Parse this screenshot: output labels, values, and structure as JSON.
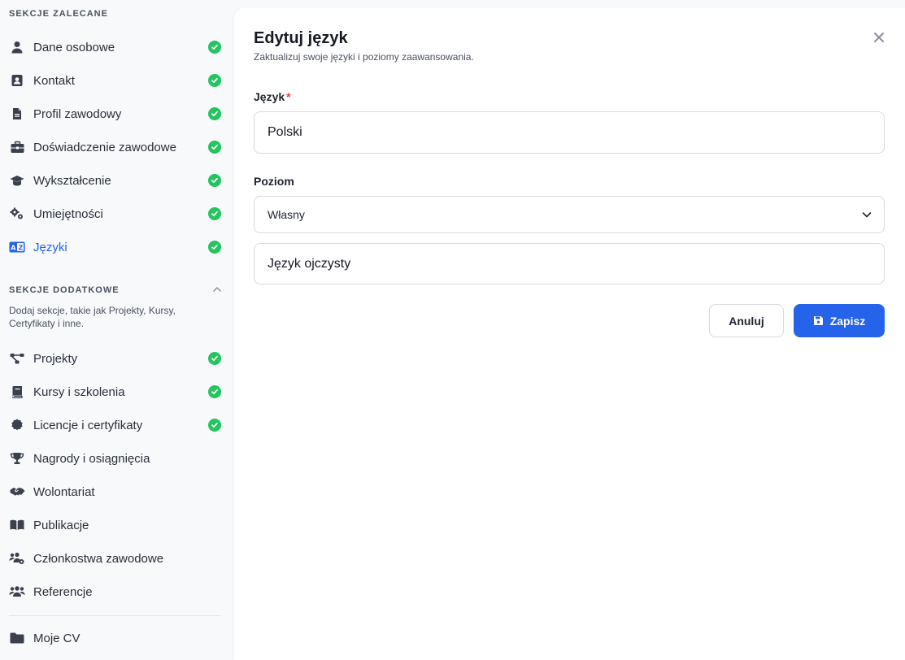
{
  "sidebar": {
    "recommended_header": "SEKCJE ZALECANE",
    "recommended_items": [
      {
        "label": "Dane osobowe",
        "icon": "user-icon",
        "done": true
      },
      {
        "label": "Kontakt",
        "icon": "contact-card-icon",
        "done": true
      },
      {
        "label": "Profil zawodowy",
        "icon": "document-icon",
        "done": true
      },
      {
        "label": "Doświadczenie zawodowe",
        "icon": "briefcase-icon",
        "done": true
      },
      {
        "label": "Wykształcenie",
        "icon": "graduation-cap-icon",
        "done": true
      },
      {
        "label": "Umiejętności",
        "icon": "gears-icon",
        "done": true
      },
      {
        "label": "Języki",
        "icon": "language-icon",
        "done": true,
        "active": true
      }
    ],
    "additional_header": "SEKCJE DODATKOWE",
    "additional_desc": "Dodaj sekcje, takie jak Projekty, Kursy, Certyfikaty i inne.",
    "additional_items": [
      {
        "label": "Projekty",
        "icon": "project-diagram-icon",
        "done": true
      },
      {
        "label": "Kursy i szkolenia",
        "icon": "book-icon",
        "done": true
      },
      {
        "label": "Licencje i certyfikaty",
        "icon": "certificate-icon",
        "done": true
      },
      {
        "label": "Nagrody i osiągnięcia",
        "icon": "trophy-icon",
        "done": false
      },
      {
        "label": "Wolontariat",
        "icon": "handshake-icon",
        "done": false
      },
      {
        "label": "Publikacje",
        "icon": "open-book-icon",
        "done": false
      },
      {
        "label": "Członkostwa zawodowe",
        "icon": "users-gear-icon",
        "done": false
      },
      {
        "label": "Referencje",
        "icon": "users-icon",
        "done": false
      }
    ],
    "footer_item": {
      "label": "Moje CV",
      "icon": "folder-icon"
    }
  },
  "modal": {
    "title": "Edytuj język",
    "subtitle": "Zaktualizuj swoje języki i poziomy zaawansowania.",
    "language_label": "Język",
    "required_mark": "*",
    "language_value": "Polski",
    "level_label": "Poziom",
    "level_selected": "Własny",
    "custom_level_value": "Język ojczysty",
    "cancel_label": "Anuluj",
    "save_label": "Zapisz"
  },
  "colors": {
    "accent": "#2563eb",
    "success": "#22c55e",
    "required": "#e53935"
  }
}
